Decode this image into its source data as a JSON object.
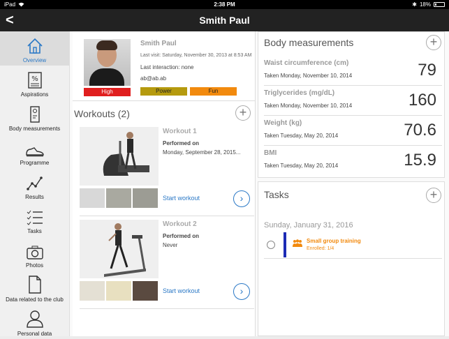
{
  "statusbar": {
    "device": "iPad",
    "time": "2:38 PM",
    "battery": "18%"
  },
  "header": {
    "title": "Smith Paul",
    "back_glyph": "<"
  },
  "sidebar": {
    "items": [
      {
        "label": "Overview",
        "icon": "home-icon",
        "active": true
      },
      {
        "label": "Aspirations",
        "icon": "percent-doc-icon"
      },
      {
        "label": "Body measurements",
        "icon": "measure-icon"
      },
      {
        "label": "Programme",
        "icon": "shoe-icon"
      },
      {
        "label": "Results",
        "icon": "line-chart-icon"
      },
      {
        "label": "Tasks",
        "icon": "checklist-icon"
      },
      {
        "label": "Photos",
        "icon": "camera-icon"
      },
      {
        "label": "Data related to the club",
        "icon": "document-icon"
      },
      {
        "label": "Personal data",
        "icon": "person-icon"
      }
    ]
  },
  "profile": {
    "name": "Smith Paul",
    "last_visit": "Last visit: Saturday, November 30, 2013 at 8:53 AM",
    "last_interaction": "Last interaction: none",
    "email": "ab@ab.ab",
    "badges": {
      "high": "High",
      "power": "Power",
      "fun": "Fun"
    },
    "colors": {
      "high": "#e01e1e",
      "power": "#b59a0e",
      "fun": "#f28a0e"
    }
  },
  "workouts": {
    "title": "Workouts (2)",
    "items": [
      {
        "title": "Workout 1",
        "performed_label": "Performed on",
        "date": "Monday, September 28, 2015...",
        "start": "Start workout"
      },
      {
        "title": "Workout 2",
        "performed_label": "Performed on",
        "date": "Never",
        "start": "Start workout"
      }
    ]
  },
  "body_measurements": {
    "title": "Body measurements",
    "items": [
      {
        "label": "Waist circumference (cm)",
        "date": "Taken Monday, November 10, 2014",
        "value": "79"
      },
      {
        "label": "Triglycerides (mg/dL)",
        "date": "Taken Monday, November 10, 2014",
        "value": "160"
      },
      {
        "label": "Weight (kg)",
        "date": "Taken Tuesday, May 20, 2014",
        "value": "70.6"
      },
      {
        "label": "BMI",
        "date": "Taken Tuesday, May 20, 2014",
        "value": "15.9"
      }
    ]
  },
  "tasks": {
    "title": "Tasks",
    "date": "Sunday, January 31, 2016",
    "items": [
      {
        "name": "Small group training",
        "status": "Enrolled: 1/4"
      }
    ]
  },
  "accent": "#2a78c6"
}
